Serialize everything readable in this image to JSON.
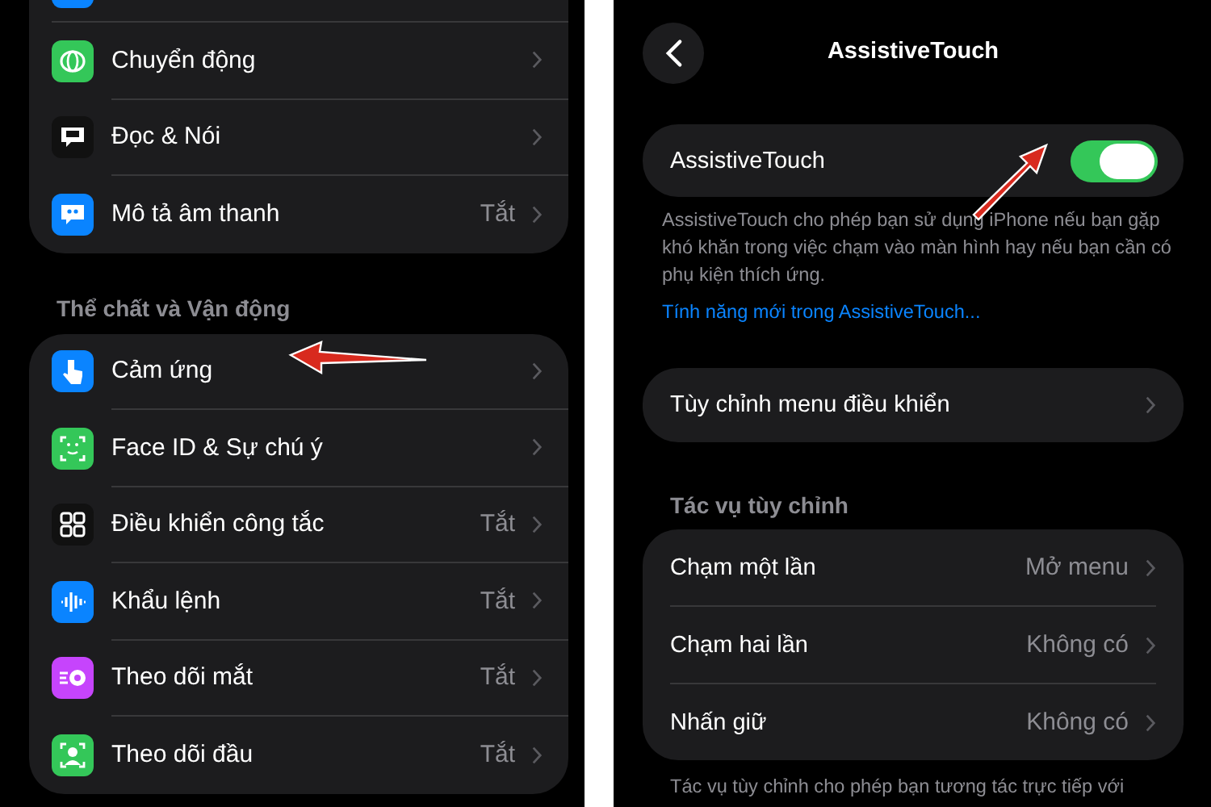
{
  "left_panel": {
    "groups": [
      {
        "rows": [
          {
            "label": "Chuyển động",
            "color": "#34c759"
          },
          {
            "label": "Đọc & Nói",
            "color": "#111111"
          },
          {
            "label": "Mô tả âm thanh",
            "value": "Tắt",
            "color": "#0a84ff"
          }
        ]
      },
      {
        "header": "Thể chất và Vận động",
        "rows": [
          {
            "label": "Cảm ứng",
            "color": "#0a84ff"
          },
          {
            "label": "Face ID & Sự chú ý",
            "color": "#34c759"
          },
          {
            "label": "Điều khiển công tắc",
            "value": "Tắt",
            "color": "#111111"
          },
          {
            "label": "Khẩu lệnh",
            "value": "Tắt",
            "color": "#0a84ff"
          },
          {
            "label": "Theo dõi mắt",
            "value": "Tắt",
            "color": "#c644fc"
          },
          {
            "label": "Theo dõi đầu",
            "value": "Tắt",
            "color": "#34c759"
          }
        ]
      }
    ]
  },
  "right_panel": {
    "title": "AssistiveTouch",
    "toggle": {
      "label": "AssistiveTouch",
      "on": true
    },
    "description": "AssistiveTouch cho phép bạn sử dụng iPhone nếu bạn gặp khó khăn trong việc chạm vào màn hình hay nếu bạn cần có phụ kiện thích ứng.",
    "link": "Tính năng mới trong AssistiveTouch...",
    "menu_row": {
      "label": "Tùy chỉnh menu điều khiển"
    },
    "section_header": "Tác vụ tùy chỉnh",
    "actions": [
      {
        "label": "Chạm một lần",
        "value": "Mở menu"
      },
      {
        "label": "Chạm hai lần",
        "value": "Không có"
      },
      {
        "label": "Nhấn giữ",
        "value": "Không có"
      }
    ],
    "footer": "Tác vụ tùy chỉnh cho phép bạn tương tác trực tiếp với"
  }
}
